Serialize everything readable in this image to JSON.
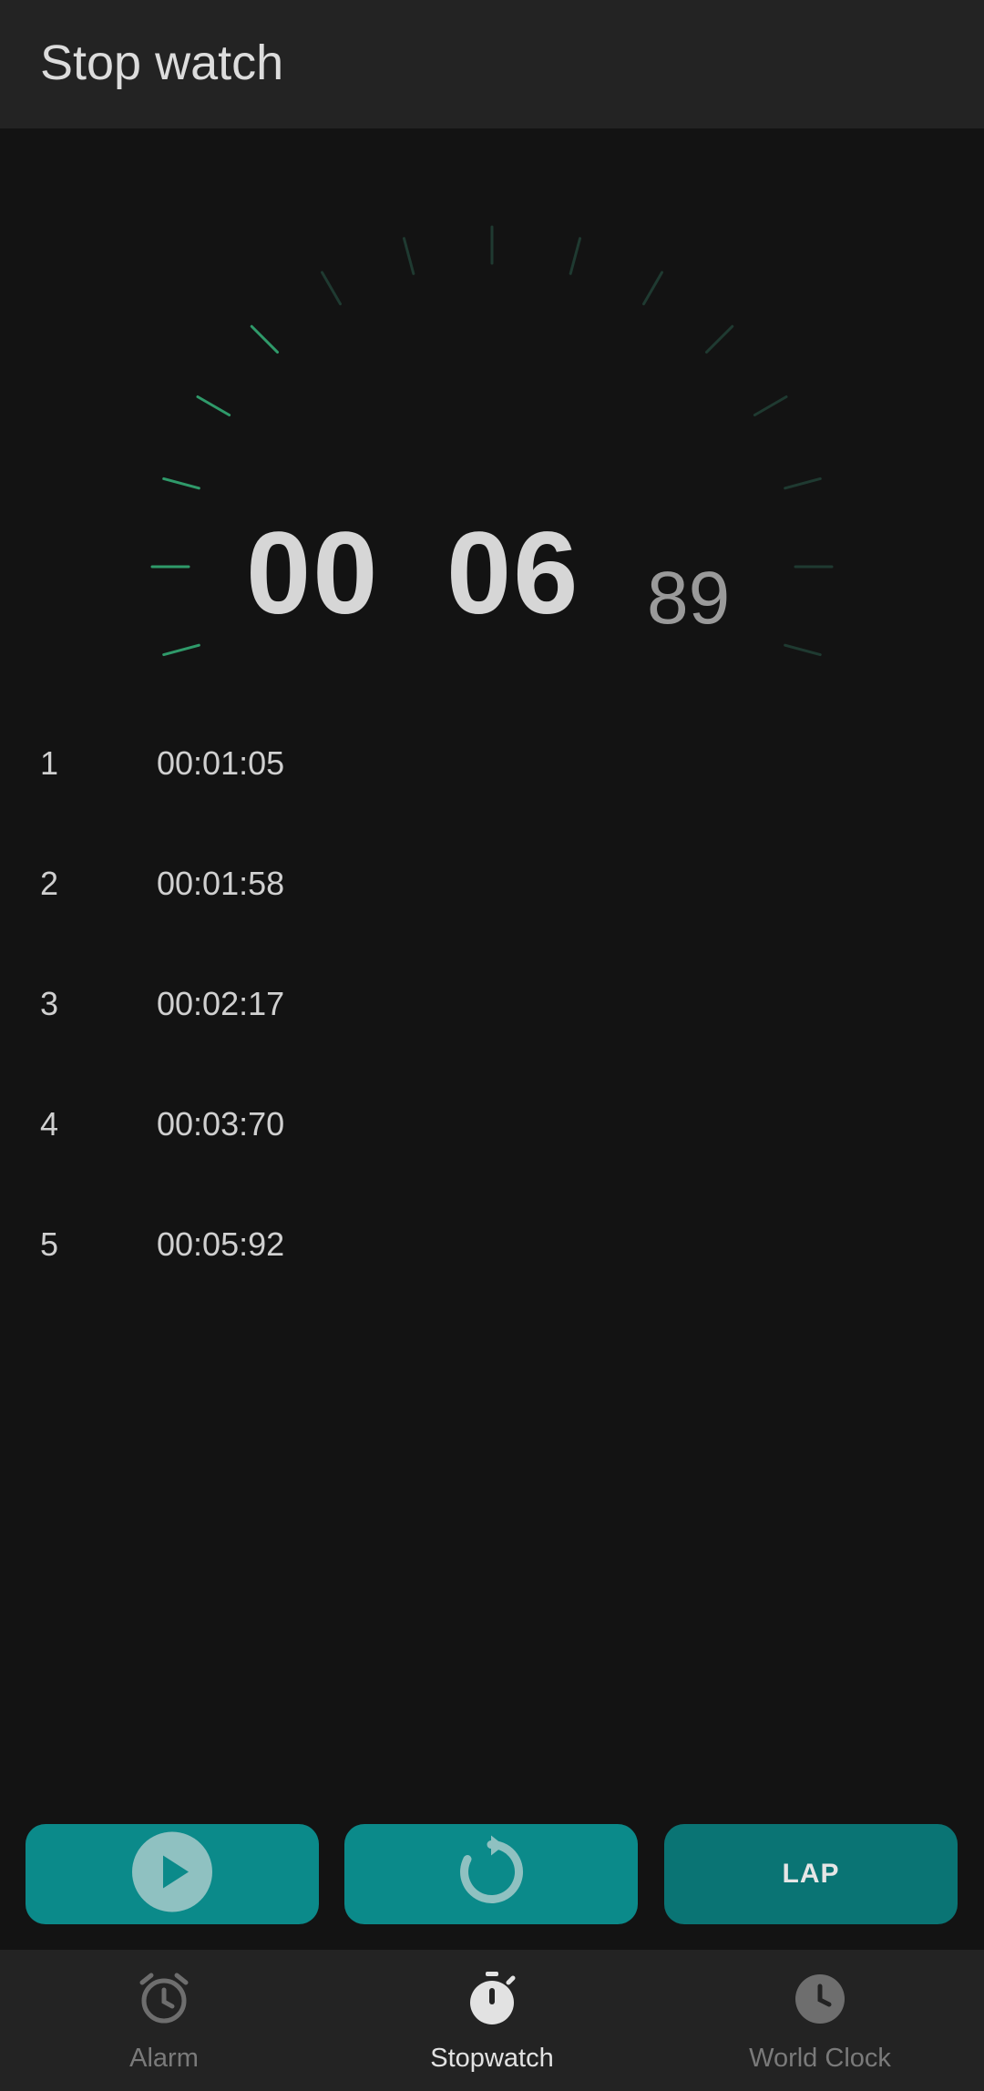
{
  "app_bar": {
    "title": "Stop watch"
  },
  "timer": {
    "minutes": "00",
    "seconds": "06",
    "hundredths": "89"
  },
  "dial": {
    "active_color": "#2f9a6a",
    "inactive_color": "#1f3a31"
  },
  "laps": [
    {
      "index": "1",
      "time": "00:01:05"
    },
    {
      "index": "2",
      "time": "00:01:58"
    },
    {
      "index": "3",
      "time": "00:02:17"
    },
    {
      "index": "4",
      "time": "00:03:70"
    },
    {
      "index": "5",
      "time": "00:05:92"
    }
  ],
  "controls": {
    "play_icon": "play-icon",
    "reset_icon": "reset-icon",
    "lap_label": "LAP",
    "button_color": "#0b8a8a"
  },
  "bottom_nav": {
    "items": [
      {
        "label": "Alarm",
        "icon": "alarm-clock-icon",
        "active": false
      },
      {
        "label": "Stopwatch",
        "icon": "stopwatch-icon",
        "active": true
      },
      {
        "label": "World Clock",
        "icon": "clock-icon",
        "active": false
      }
    ]
  }
}
